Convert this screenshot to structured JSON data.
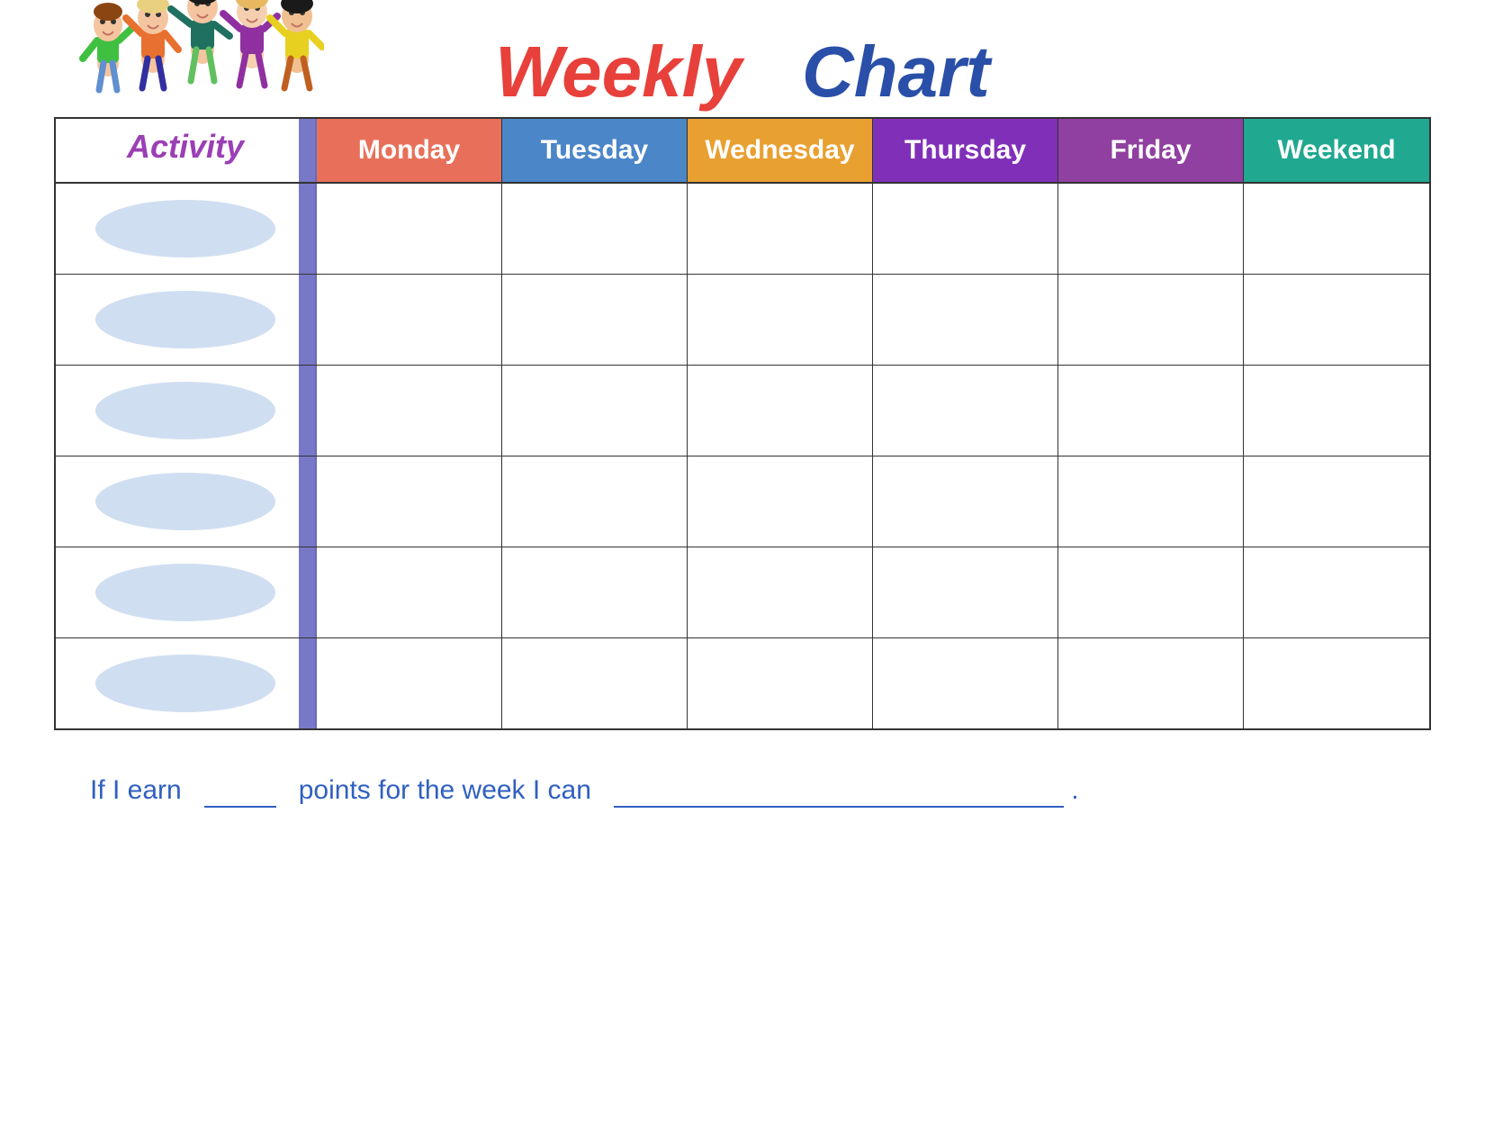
{
  "title": {
    "weekly": "Weekly",
    "chart": "Chart"
  },
  "header": {
    "activity_label": "Activity",
    "days": [
      {
        "id": "monday",
        "label": "Monday",
        "class": "day-monday"
      },
      {
        "id": "tuesday",
        "label": "Tuesday",
        "class": "day-tuesday"
      },
      {
        "id": "wednesday",
        "label": "Wednesday",
        "class": "day-wednesday"
      },
      {
        "id": "thursday",
        "label": "Thursday",
        "class": "day-thursday"
      },
      {
        "id": "friday",
        "label": "Friday",
        "class": "day-friday"
      },
      {
        "id": "weekend",
        "label": "Weekend",
        "class": "day-weekend"
      }
    ]
  },
  "rows": [
    {
      "id": "row1"
    },
    {
      "id": "row2"
    },
    {
      "id": "row3"
    },
    {
      "id": "row4"
    },
    {
      "id": "row5"
    },
    {
      "id": "row6"
    }
  ],
  "footer": {
    "text_before": "If I earn",
    "text_middle": "points for the week I can",
    "text_end": "."
  }
}
